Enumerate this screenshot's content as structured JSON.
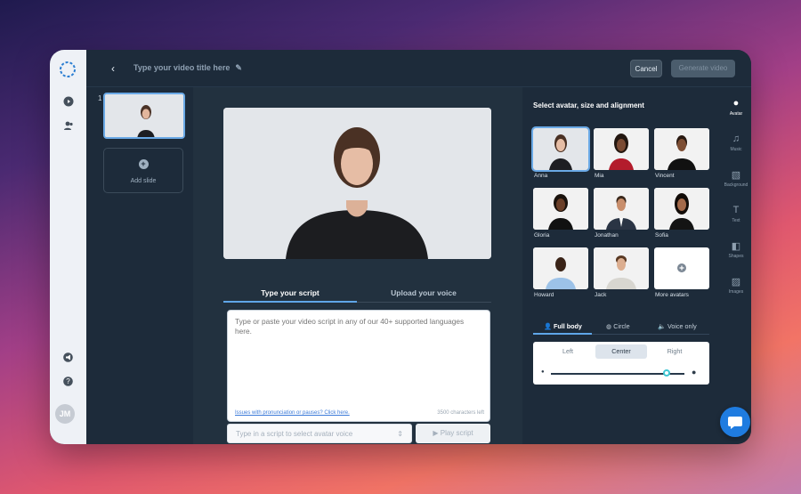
{
  "header": {
    "title_placeholder": "Type your video title here",
    "cancel": "Cancel",
    "generate": "Generate video"
  },
  "rail": {
    "initials": "JM"
  },
  "slides": {
    "number": "1",
    "add_label": "Add slide"
  },
  "editor": {
    "tabs": [
      "Type your script",
      "Upload your voice"
    ],
    "script_placeholder": "Type or paste your video script in any of our 40+ supported languages here.",
    "help_link": "Issues with pronunciation or pauses? Click here.",
    "char_count": "3500 characters left",
    "avatar_select_placeholder": "Type in a script to select avatar voice",
    "play_label": "Play script"
  },
  "avatar_panel": {
    "heading": "Select avatar, size and alignment",
    "avatars": [
      "Anna",
      "Mia",
      "Vincent",
      "Gloria",
      "Jonathan",
      "Sofia",
      "Howard",
      "Jack",
      "More avatars"
    ],
    "body_tabs": [
      "Full body",
      "Circle",
      "Voice only"
    ],
    "alignment": [
      "Left",
      "Center",
      "Right"
    ],
    "selected_alignment": "Center",
    "size_level": 0.95
  },
  "sidebar": [
    "Avatar",
    "Music",
    "Background",
    "Text",
    "Shapes",
    "Images"
  ],
  "colors": {
    "accent": "#5fa6e8",
    "panel": "#1d2b3a",
    "chat": "#1f7ce0"
  }
}
